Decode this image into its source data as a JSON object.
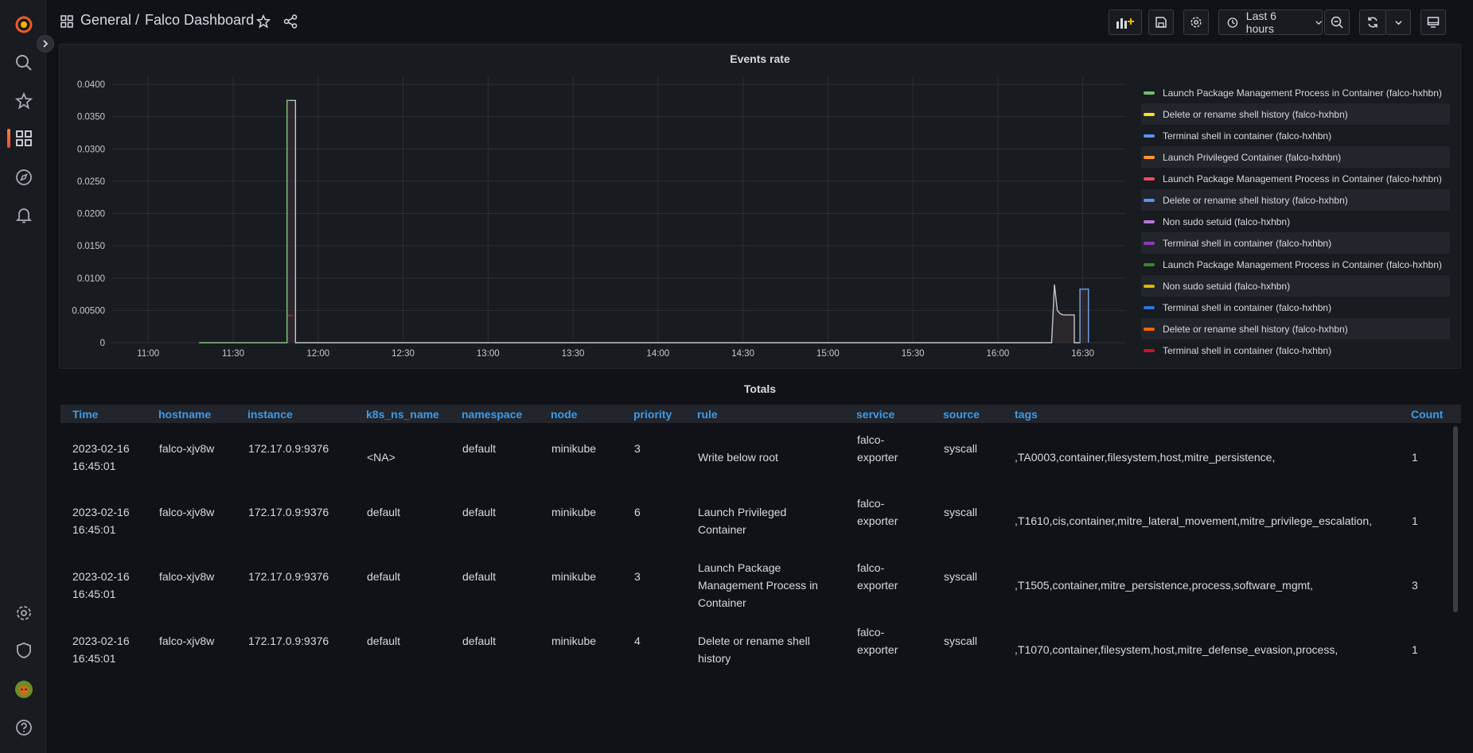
{
  "breadcrumb": {
    "folder": "General",
    "separator": "/",
    "dashboard": "Falco Dashboard"
  },
  "toolbar": {
    "time_range": "Last 6 hours"
  },
  "icons": [
    "grafana-logo-icon",
    "search-icon",
    "star-icon",
    "dashboards-icon",
    "explore-icon",
    "alerting-icon",
    "settings-icon",
    "shield-icon",
    "avatar",
    "help-icon",
    "add-panel-icon",
    "save-icon",
    "gear-icon",
    "clock-icon",
    "zoom-out-icon",
    "refresh-icon",
    "chevron-down-icon",
    "tv-icon",
    "share-icon",
    "grid-icon",
    "chevron-right-icon"
  ],
  "colors": {
    "accent": "#3d9be9",
    "brand_orange": "#f05a28"
  },
  "events_panel": {
    "title": "Events rate",
    "legend": [
      {
        "label": "Launch Package Management Process in Container (falco-hxhbn)",
        "color": "#73bf69"
      },
      {
        "label": "Delete or rename shell history (falco-hxhbn)",
        "color": "#fade2a"
      },
      {
        "label": "Terminal shell in container (falco-hxhbn)",
        "color": "#5794f2"
      },
      {
        "label": "Launch Privileged Container (falco-hxhbn)",
        "color": "#ff9830"
      },
      {
        "label": "Launch Package Management Process in Container (falco-hxhbn)",
        "color": "#f2495c"
      },
      {
        "label": "Delete or rename shell history (falco-hxhbn)",
        "color": "#5794f2"
      },
      {
        "label": "Non sudo setuid (falco-hxhbn)",
        "color": "#b877d9"
      },
      {
        "label": "Terminal shell in container (falco-hxhbn)",
        "color": "#8f3bb8"
      },
      {
        "label": "Launch Package Management Process in Container (falco-hxhbn)",
        "color": "#37872d"
      },
      {
        "label": "Non sudo setuid (falco-hxhbn)",
        "color": "#e0b400"
      },
      {
        "label": "Terminal shell in container (falco-hxhbn)",
        "color": "#3274d9"
      },
      {
        "label": "Delete or rename shell history (falco-hxhbn)",
        "color": "#fa6400"
      },
      {
        "label": "Terminal shell in container (falco-hxhbn)",
        "color": "#c4162a"
      }
    ]
  },
  "chart_data": {
    "type": "line",
    "title": "Events rate",
    "y_ticks": [
      "0.0400",
      "0.0350",
      "0.0300",
      "0.0250",
      "0.0200",
      "0.0150",
      "0.0100",
      "0.00500",
      "0"
    ],
    "x_ticks": [
      "11:00",
      "11:30",
      "12:00",
      "12:30",
      "13:00",
      "13:30",
      "14:00",
      "14:30",
      "15:00",
      "15:30",
      "16:00",
      "16:30"
    ],
    "ylim": [
      0,
      0.04
    ],
    "x_range_minutes": [
      "10:47",
      "16:45"
    ],
    "series": [
      {
        "color": "#c4c6cc",
        "points": [
          [
            "11:18",
            0
          ],
          [
            "11:49",
            0
          ],
          [
            "11:49",
            0.0375
          ],
          [
            "11:52",
            0.0375
          ],
          [
            "11:52",
            0
          ],
          [
            "16:19",
            0
          ],
          [
            "16:20",
            0.009
          ],
          [
            "16:21",
            0.005
          ],
          [
            "16:22",
            0.0045
          ],
          [
            "16:23",
            0.0043
          ],
          [
            "16:27",
            0.0043
          ],
          [
            "16:27",
            0
          ],
          [
            "16:29",
            0
          ],
          [
            "16:29",
            0.0083
          ],
          [
            "16:32",
            0.0083
          ],
          [
            "16:32",
            0
          ]
        ]
      },
      {
        "color": "#73bf69",
        "points": [
          [
            "11:18",
            0
          ],
          [
            "11:49",
            0
          ],
          [
            "11:49",
            0.0375
          ],
          [
            "11:50",
            0.0375
          ]
        ]
      },
      {
        "color": "#5794f2",
        "points": [
          [
            "16:29",
            0
          ],
          [
            "16:29",
            0.0083
          ],
          [
            "16:32",
            0.0083
          ],
          [
            "16:32",
            0
          ]
        ]
      },
      {
        "color": "#e02f44",
        "points": [
          [
            "11:49",
            0.0042
          ],
          [
            "11:51",
            0.0042
          ]
        ]
      }
    ]
  },
  "totals": {
    "title": "Totals",
    "columns": [
      "Time",
      "hostname",
      "instance",
      "k8s_ns_name",
      "namespace",
      "node",
      "priority",
      "rule",
      "service",
      "source",
      "tags",
      "Count"
    ],
    "rows": [
      {
        "time1": "2023-02-16",
        "time2": "16:45:01",
        "hostname": "falco-xjv8w",
        "instance": "172.17.0.9:9376",
        "k8s_ns_name": "<NA>",
        "namespace": "default",
        "node": "minikube",
        "priority": "3",
        "rule1": "Write below root",
        "rule2": "",
        "rule3": "",
        "service1": "falco-",
        "service2": "exporter",
        "source": "syscall",
        "tags": ",TA0003,container,filesystem,host,mitre_persistence,",
        "count": "1"
      },
      {
        "time1": "2023-02-16",
        "time2": "16:45:01",
        "hostname": "falco-xjv8w",
        "instance": "172.17.0.9:9376",
        "k8s_ns_name": "default",
        "namespace": "default",
        "node": "minikube",
        "priority": "6",
        "rule1": "Launch Privileged",
        "rule2": "Container",
        "rule3": "",
        "service1": "falco-",
        "service2": "exporter",
        "source": "syscall",
        "tags": ",T1610,cis,container,mitre_lateral_movement,mitre_privilege_escalation,",
        "count": "1"
      },
      {
        "time1": "2023-02-16",
        "time2": "16:45:01",
        "hostname": "falco-xjv8w",
        "instance": "172.17.0.9:9376",
        "k8s_ns_name": "default",
        "namespace": "default",
        "node": "minikube",
        "priority": "3",
        "rule1": "Launch Package",
        "rule2": "Management Process in",
        "rule3": "Container",
        "service1": "falco-",
        "service2": "exporter",
        "source": "syscall",
        "tags": ",T1505,container,mitre_persistence,process,software_mgmt,",
        "count": "3"
      },
      {
        "time1": "2023-02-16",
        "time2": "16:45:01",
        "hostname": "falco-xjv8w",
        "instance": "172.17.0.9:9376",
        "k8s_ns_name": "default",
        "namespace": "default",
        "node": "minikube",
        "priority": "4",
        "rule1": "Delete or rename shell",
        "rule2": "history",
        "rule3": "",
        "service1": "falco-",
        "service2": "exporter",
        "source": "syscall",
        "tags": ",T1070,container,filesystem,host,mitre_defense_evasion,process,",
        "count": "1"
      }
    ]
  }
}
